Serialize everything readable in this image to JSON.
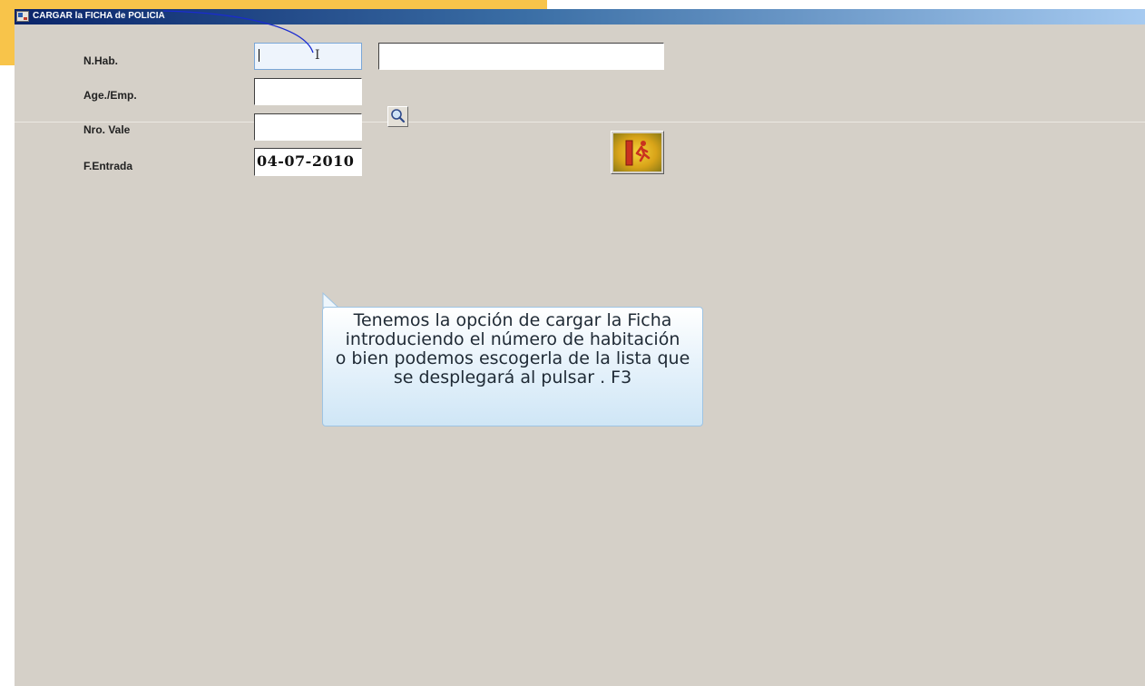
{
  "window": {
    "title": "CARGAR la FICHA de POLICIA"
  },
  "form": {
    "nhab_label": "N.Hab.",
    "nhab_value": "",
    "nhab_desc_value": "",
    "age_label": "Age./Emp.",
    "age_value": "",
    "vale_label": "Nro. Vale",
    "vale_value": "",
    "entrada_label": "F.Entrada",
    "entrada_value": "04-07-2010"
  },
  "buttons": {
    "search_icon": "magnifier-icon",
    "exit_icon": "exit-door-runner-icon"
  },
  "tooltip": {
    "lines": [
      "Tenemos la opción de cargar la Ficha",
      "introduciendo el número de habitación",
      "o bien podemos escogerla de la lista que",
      "se desplegará al pulsar . F3"
    ]
  },
  "colors": {
    "window_bg": "#d5d0c8",
    "titlebar_start": "#0a246a",
    "titlebar_end": "#a6caf0",
    "slide_accent": "#f8c44a",
    "callout_line": "#1a2bd0"
  }
}
